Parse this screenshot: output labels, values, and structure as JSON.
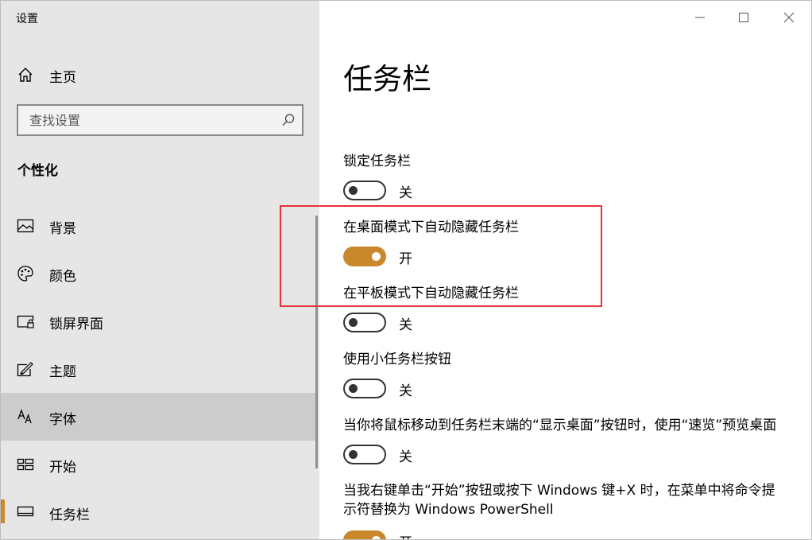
{
  "window": {
    "title": "设置"
  },
  "sidebar": {
    "home_label": "主页",
    "search_placeholder": "查找设置",
    "section_header": "个性化",
    "items": [
      {
        "label": "背景",
        "icon": "picture-icon"
      },
      {
        "label": "颜色",
        "icon": "palette-icon"
      },
      {
        "label": "锁屏界面",
        "icon": "lock-screen-icon"
      },
      {
        "label": "主题",
        "icon": "theme-icon"
      },
      {
        "label": "字体",
        "icon": "font-icon"
      },
      {
        "label": "开始",
        "icon": "start-icon"
      },
      {
        "label": "任务栏",
        "icon": "taskbar-icon"
      }
    ]
  },
  "main": {
    "page_title": "任务栏",
    "settings": [
      {
        "label": "锁定任务栏",
        "state": "关",
        "on": false
      },
      {
        "label": "在桌面模式下自动隐藏任务栏",
        "state": "开",
        "on": true
      },
      {
        "label": "在平板模式下自动隐藏任务栏",
        "state": "关",
        "on": false
      },
      {
        "label": "使用小任务栏按钮",
        "state": "关",
        "on": false
      },
      {
        "label": "当你将鼠标移动到任务栏末端的“显示桌面”按钮时，使用“速览”预览桌面",
        "state": "关",
        "on": false
      },
      {
        "label": "当我右键单击“开始”按钮或按下 Windows 键+X 时，在菜单中将命令提示符替换为 Windows PowerShell",
        "state": "开",
        "on": true
      }
    ]
  },
  "colors": {
    "accent": "#c9882c",
    "highlight_box": "#e5333a",
    "sidebar_bg": "#e6e6e6",
    "selected_bg": "#cccccc"
  }
}
